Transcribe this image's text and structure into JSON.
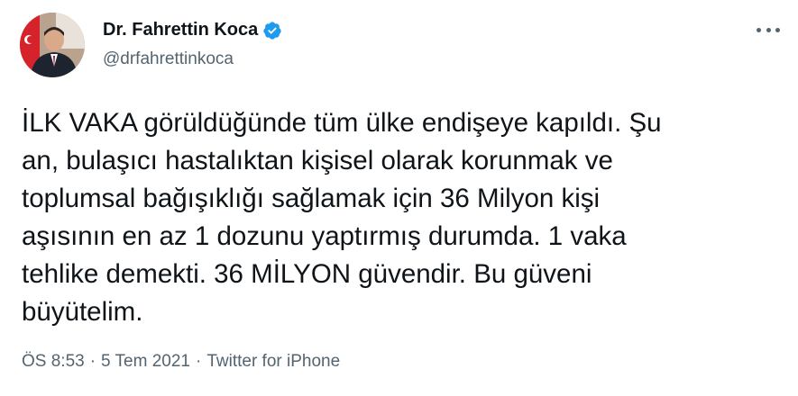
{
  "author": {
    "display_name": "Dr. Fahrettin Koca",
    "handle": "@drfahrettinkoca",
    "verified": true,
    "avatar_icon": "profile-photo"
  },
  "more_icon": "more-options-icon",
  "tweet": {
    "text": "İLK VAKA görüldüğünde tüm ülke endişeye kapıldı. Şu\nan, bulaşıcı hastalıktan kişisel olarak korunmak ve\ntoplumsal bağışıklığı sağlamak için 36 Milyon kişi\naşısının en az 1 dozunu yaptırmış durumda. 1 vaka\ntehlike demekti. 36 MİLYON güvendir. Bu güveni\nbüyütelim."
  },
  "meta": {
    "time": "ÖS 8:53",
    "separator": "·",
    "date": "5 Tem 2021",
    "source": "Twitter for iPhone"
  },
  "colors": {
    "text": "#0f1419",
    "secondary": "#536471",
    "verified": "#1d9bf0"
  }
}
